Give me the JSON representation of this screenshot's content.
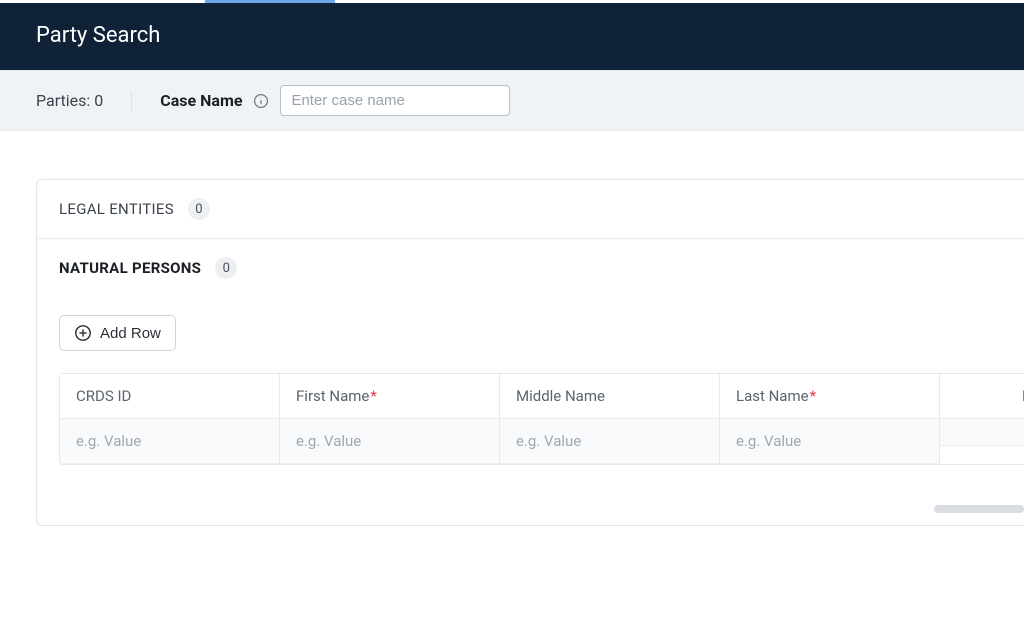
{
  "header": {
    "title": "Party Search"
  },
  "subbar": {
    "parties_label": "Parties: 0",
    "case_name_label": "Case Name",
    "case_name_placeholder": "Enter case name"
  },
  "sections": {
    "legal_entities": {
      "label": "LEGAL ENTITIES",
      "count": "0"
    },
    "natural_persons": {
      "label": "NATURAL PERSONS",
      "count": "0"
    }
  },
  "actions": {
    "add_row": "Add Row"
  },
  "table": {
    "columns": {
      "crds_id": {
        "label": "CRDS ID",
        "required": false,
        "placeholder": "e.g. Value"
      },
      "first_name": {
        "label": "First Name",
        "required": true,
        "placeholder": "e.g. Value"
      },
      "middle_name": {
        "label": "Middle Name",
        "required": false,
        "placeholder": "e.g. Value"
      },
      "last_name": {
        "label": "Last Name",
        "required": true,
        "placeholder": "e.g. Value"
      },
      "overflow": {
        "label": "Da"
      }
    }
  }
}
